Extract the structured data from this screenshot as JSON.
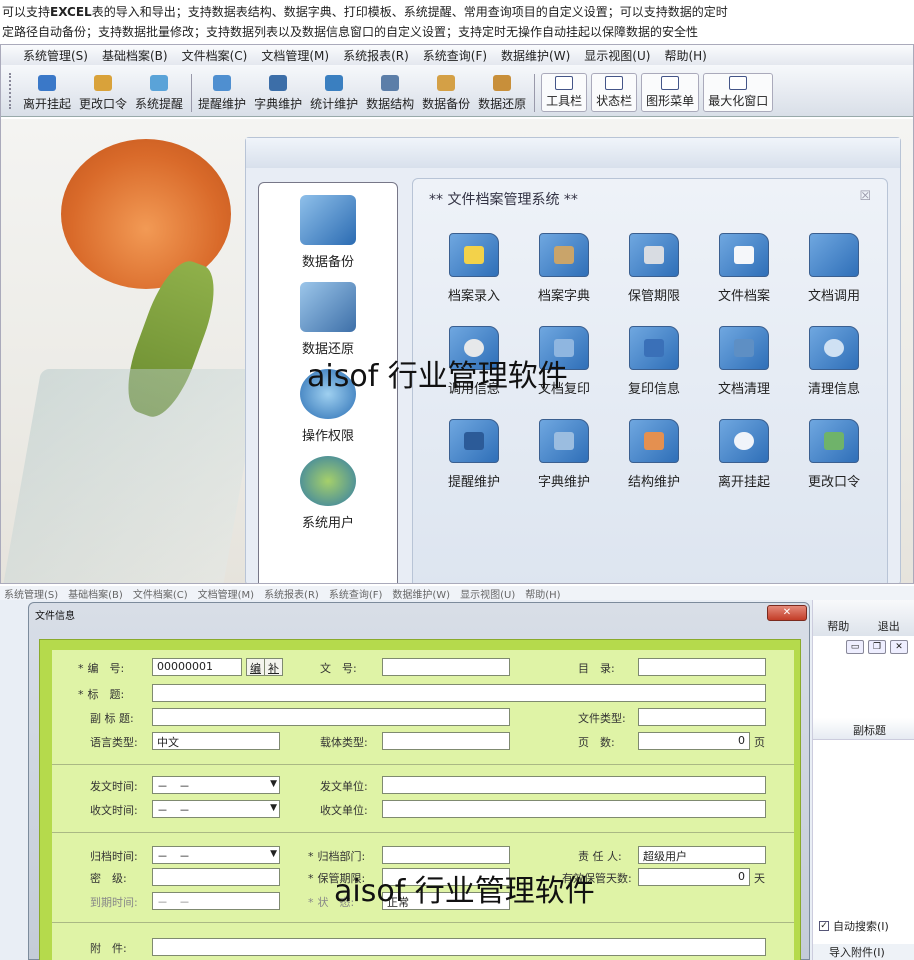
{
  "intro": {
    "line1_pre": "可以支持",
    "line1_bold": "EXCEL",
    "line1_rest": "表的导入和导出；支持数据表结构、数据字典、打印模板、系统提醒、常用查询项目的自定义设置；可以支持数据的定时",
    "line2": "定路径自动备份；支持数据批量修改；支持数据列表以及数据信息窗口的自定义设置；支持定时无操作自动挂起以保障数据的安全性"
  },
  "menu": [
    "系统管理(S)",
    "基础档案(B)",
    "文件档案(C)",
    "文档管理(M)",
    "系统报表(R)",
    "系统查询(F)",
    "数据维护(W)",
    "显示视图(U)",
    "帮助(H)"
  ],
  "toolbar": {
    "left": [
      "离开挂起",
      "更改口令",
      "系统提醒"
    ],
    "mid": [
      "提醒维护",
      "字典维护",
      "统计维护",
      "数据结构",
      "数据备份",
      "数据还原"
    ],
    "right": [
      "工具栏",
      "状态栏",
      "图形菜单",
      "最大化窗口"
    ]
  },
  "left_pane": [
    "数据备份",
    "数据还原",
    "操作权限",
    "系统用户"
  ],
  "right_pane": {
    "title": "** 文件档案管理系统 **",
    "close": "☒",
    "items": [
      "档案录入",
      "档案字典",
      "保管期限",
      "文件档案",
      "文档调用",
      "调用信息",
      "文档复印",
      "复印信息",
      "文档清理",
      "清理信息",
      "提醒维护",
      "字典维护",
      "结构维护",
      "离开挂起",
      "更改口令"
    ]
  },
  "watermark": "aisof 行业管理软件",
  "menu2": [
    "系统管理(S)",
    "基础档案(B)",
    "文件档案(C)",
    "文档管理(M)",
    "系统报表(R)",
    "系统查询(F)",
    "数据维护(W)",
    "显示视图(U)",
    "帮助(H)"
  ],
  "side": {
    "help": "帮助",
    "exit": "退出",
    "col_header": "副标题",
    "auto_search": "自动搜索(I)",
    "import_attach": "导入附件(I)"
  },
  "dialog": {
    "title": "文件信息",
    "close": "✕",
    "labels": {
      "code": "编　号:",
      "doc_no": "文　号:",
      "catalog": "目　录:",
      "title": "标　题:",
      "subtitle": "副 标 题:",
      "file_type": "文件类型:",
      "lang": "语言类型:",
      "carrier": "载体类型:",
      "pages": "页　数:",
      "pages_unit": "页",
      "send_time": "发文时间:",
      "send_unit": "发文单位:",
      "recv_time": "收文时间:",
      "recv_unit": "收文单位:",
      "archive_time": "归档时间:",
      "archive_dept": "归档部门:",
      "owner": "责 任 人:",
      "secret": "密　级:",
      "keep_period": "保管期限:",
      "keep_days": "有效保管天数:",
      "expire": "到期时间:",
      "status": "状　态:",
      "days_unit": "天",
      "attach": "附　件:"
    },
    "values": {
      "code": "00000001",
      "btn_code": "编",
      "btn_fill": "补",
      "lang": "中文",
      "pages": "0",
      "date_blank": "－　－",
      "owner": "超级用户",
      "keep_days": "0",
      "status": "正常"
    }
  }
}
